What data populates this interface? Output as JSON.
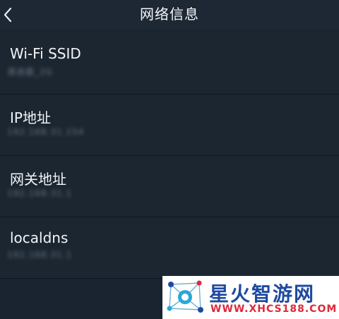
{
  "header": {
    "title": "网络信息",
    "back_icon": "chevron-left-icon"
  },
  "rows": [
    {
      "label": "Wi-Fi SSID",
      "value": "清迷鹿_2G"
    },
    {
      "label": "IP地址",
      "value": "192.168.31.154"
    },
    {
      "label": "网关地址",
      "value": "192.168.31.1"
    },
    {
      "label": "localdns",
      "value": "192.168.31.1"
    }
  ],
  "watermark": {
    "name": "星火智游网",
    "url": "WWW.XHCS188.COM",
    "colors": {
      "name": "#1e4aa0",
      "url": "#e0283a"
    }
  },
  "colors": {
    "background": "#1a2430",
    "divider": "#0f1720",
    "text": "#f2f4f6"
  }
}
